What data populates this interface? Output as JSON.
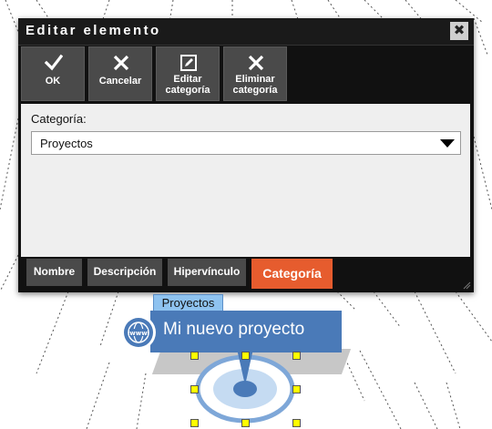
{
  "dialog": {
    "title": "Editar elemento",
    "close_glyph": "✖",
    "toolbar": [
      {
        "label": "OK",
        "icon": "check-icon"
      },
      {
        "label": "Cancelar",
        "icon": "x-icon"
      },
      {
        "label": "Editar categoría",
        "label_lines": [
          "Editar",
          "categoría"
        ],
        "icon": "edit-icon"
      },
      {
        "label": "Eliminar categoría",
        "label_lines": [
          "Eliminar",
          "categoría"
        ],
        "icon": "x-icon"
      }
    ],
    "field_label": "Categoría:",
    "category_value": "Proyectos",
    "tabs": [
      "Nombre",
      "Descripción",
      "Hipervínculo",
      "Categoría"
    ],
    "active_tab": "Categoría"
  },
  "canvas": {
    "category_tag": "Proyectos",
    "node_title": "Mi nuevo proyecto",
    "node_icon": "globe-www-icon"
  },
  "colors": {
    "active_tab": "#e65c2e",
    "node": "#4a7ab8",
    "tag": "#8fc3f0",
    "handle": "#ffff00"
  }
}
